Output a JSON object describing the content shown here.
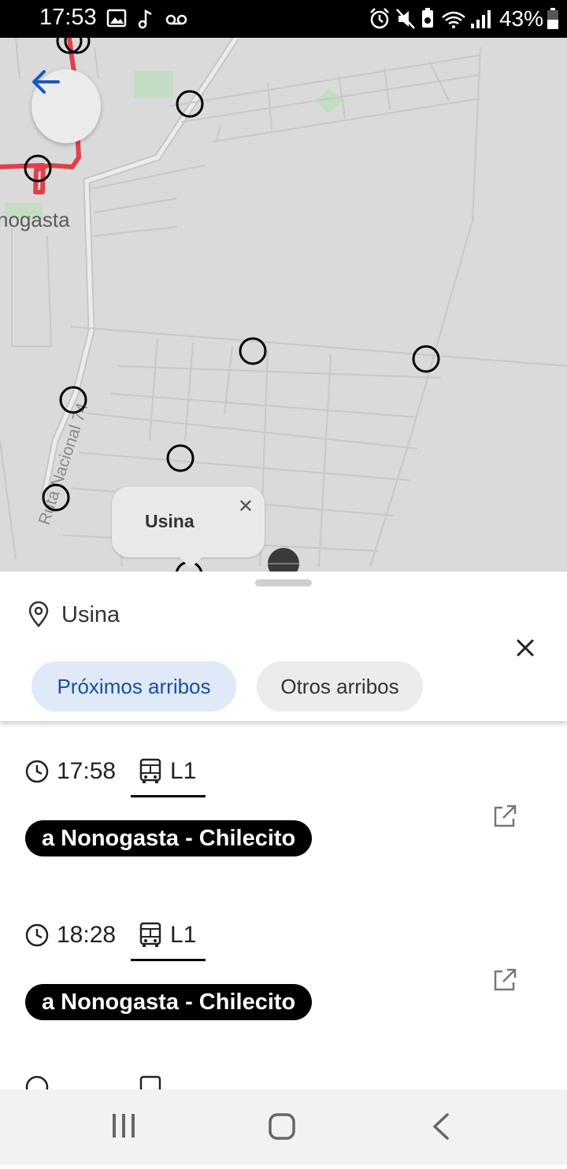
{
  "status_bar": {
    "time": "17:53",
    "left_icons": [
      "image-icon",
      "music-note-icon",
      "voicemail-icon"
    ],
    "right_icons": [
      "alarm-icon",
      "mute-icon",
      "battery-saver-icon",
      "wifi-icon",
      "signal-icon"
    ],
    "battery_percent": "43%"
  },
  "map": {
    "place_label": "nogasta",
    "road_label": "Ruta Nacional 74",
    "popup": {
      "title": "Usina"
    },
    "route_color": "#e0404a"
  },
  "sheet": {
    "stop_name": "Usina",
    "tabs": [
      {
        "label": "Próximos arribos",
        "active": true
      },
      {
        "label": "Otros arribos",
        "active": false
      }
    ]
  },
  "arrivals": [
    {
      "time": "17:58",
      "route": "L1",
      "destination": "a Nonogasta - Chilecito"
    },
    {
      "time": "18:28",
      "route": "L1",
      "destination": "a Nonogasta - Chilecito"
    }
  ],
  "accent_color": "#1a56c8"
}
